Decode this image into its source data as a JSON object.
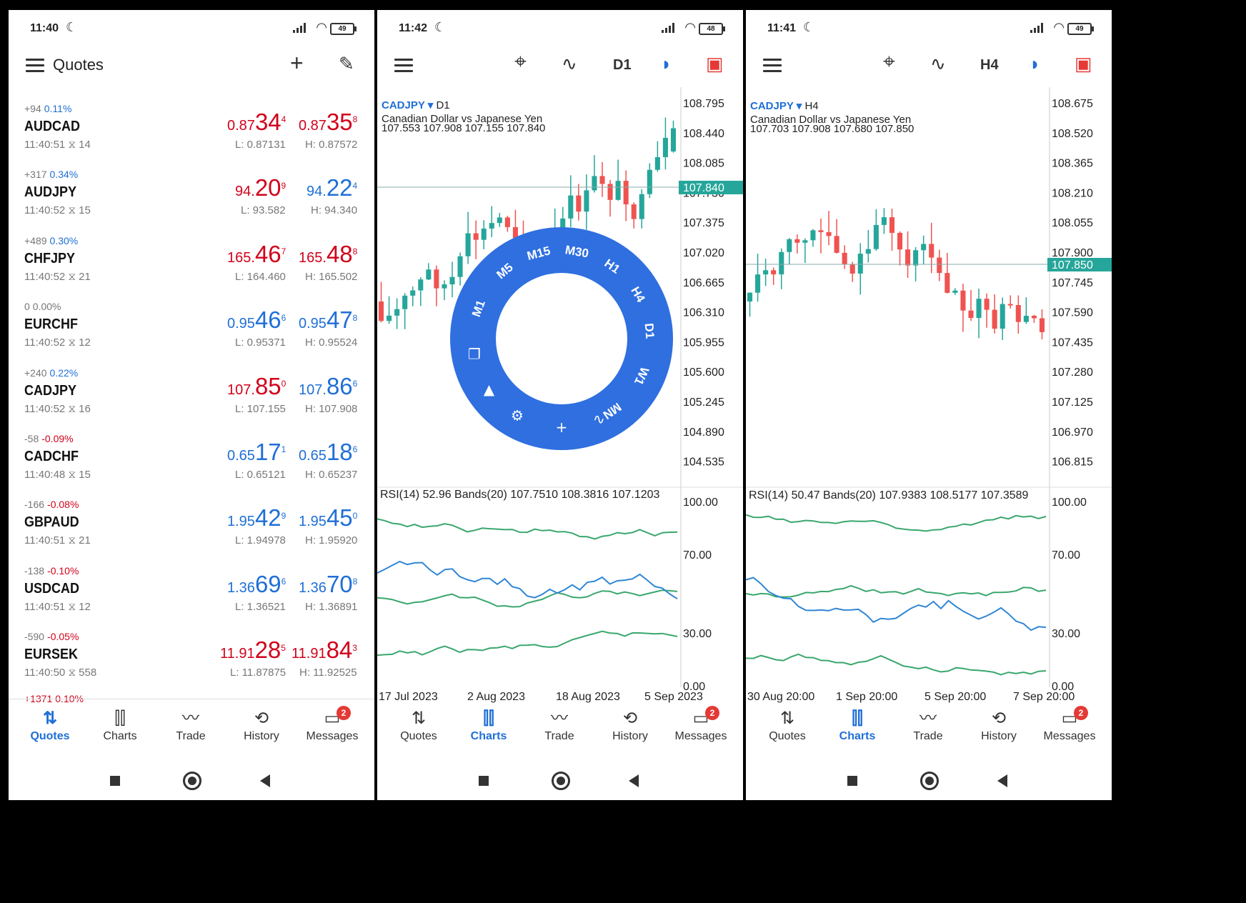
{
  "status": [
    {
      "time": "11:40",
      "battery": "49"
    },
    {
      "time": "11:42",
      "battery": "48"
    },
    {
      "time": "11:41",
      "battery": "49"
    }
  ],
  "quotes_screen": {
    "title": "Quotes",
    "rows": [
      {
        "chg": "+94",
        "pct": "0.11%",
        "pct_dir": "up",
        "symbol": "AUDCAD",
        "time": "11:40:51",
        "spread": "14",
        "bid_pre": "0.87",
        "bid_big": "34",
        "bid_sup": "4",
        "bid_color": "red",
        "ask_pre": "0.87",
        "ask_big": "35",
        "ask_sup": "8",
        "ask_color": "red",
        "low": "L: 0.87131",
        "high": "H: 0.87572"
      },
      {
        "chg": "+317",
        "pct": "0.34%",
        "pct_dir": "up",
        "symbol": "AUDJPY",
        "time": "11:40:52",
        "spread": "15",
        "bid_pre": "94.",
        "bid_big": "20",
        "bid_sup": "9",
        "bid_color": "red",
        "ask_pre": "94.",
        "ask_big": "22",
        "ask_sup": "4",
        "ask_color": "blue",
        "low": "L: 93.582",
        "high": "H: 94.340"
      },
      {
        "chg": "+489",
        "pct": "0.30%",
        "pct_dir": "up",
        "symbol": "CHFJPY",
        "time": "11:40:52",
        "spread": "21",
        "bid_pre": "165.",
        "bid_big": "46",
        "bid_sup": "7",
        "bid_color": "red",
        "ask_pre": "165.",
        "ask_big": "48",
        "ask_sup": "8",
        "ask_color": "red",
        "low": "L: 164.460",
        "high": "H: 165.502"
      },
      {
        "chg": "0",
        "pct": "0.00%",
        "pct_dir": "flat",
        "symbol": "EURCHF",
        "time": "11:40:52",
        "spread": "12",
        "bid_pre": "0.95",
        "bid_big": "46",
        "bid_sup": "6",
        "bid_color": "blue",
        "ask_pre": "0.95",
        "ask_big": "47",
        "ask_sup": "8",
        "ask_color": "blue",
        "low": "L: 0.95371",
        "high": "H: 0.95524"
      },
      {
        "chg": "+240",
        "pct": "0.22%",
        "pct_dir": "up",
        "symbol": "CADJPY",
        "time": "11:40:52",
        "spread": "16",
        "bid_pre": "107.",
        "bid_big": "85",
        "bid_sup": "0",
        "bid_color": "red",
        "ask_pre": "107.",
        "ask_big": "86",
        "ask_sup": "6",
        "ask_color": "blue",
        "low": "L: 107.155",
        "high": "H: 107.908"
      },
      {
        "chg": "-58",
        "pct": "-0.09%",
        "pct_dir": "down",
        "symbol": "CADCHF",
        "time": "11:40:48",
        "spread": "15",
        "bid_pre": "0.65",
        "bid_big": "17",
        "bid_sup": "1",
        "bid_color": "blue",
        "ask_pre": "0.65",
        "ask_big": "18",
        "ask_sup": "6",
        "ask_color": "blue",
        "low": "L: 0.65121",
        "high": "H: 0.65237"
      },
      {
        "chg": "-166",
        "pct": "-0.08%",
        "pct_dir": "down",
        "symbol": "GBPAUD",
        "time": "11:40:51",
        "spread": "21",
        "bid_pre": "1.95",
        "bid_big": "42",
        "bid_sup": "9",
        "bid_color": "blue",
        "ask_pre": "1.95",
        "ask_big": "45",
        "ask_sup": "0",
        "ask_color": "blue",
        "low": "L: 1.94978",
        "high": "H: 1.95920"
      },
      {
        "chg": "-138",
        "pct": "-0.10%",
        "pct_dir": "down",
        "symbol": "USDCAD",
        "time": "11:40:51",
        "spread": "12",
        "bid_pre": "1.36",
        "bid_big": "69",
        "bid_sup": "6",
        "bid_color": "blue",
        "ask_pre": "1.36",
        "ask_big": "70",
        "ask_sup": "8",
        "ask_color": "blue",
        "low": "L: 1.36521",
        "high": "H: 1.36891"
      },
      {
        "chg": "-590",
        "pct": "-0.05%",
        "pct_dir": "down",
        "symbol": "EURSEK",
        "time": "11:40:50",
        "spread": "558",
        "bid_pre": "11.91",
        "bid_big": "28",
        "bid_sup": "5",
        "bid_color": "red",
        "ask_pre": "11.91",
        "ask_big": "84",
        "ask_sup": "3",
        "ask_color": "red",
        "low": "L: 11.87875",
        "high": "H: 11.92525"
      }
    ],
    "partial_row": "+1371 0.10%"
  },
  "nav": {
    "items": [
      "Quotes",
      "Charts",
      "Trade",
      "History",
      "Messages"
    ],
    "badge": "2"
  },
  "charts": [
    {
      "symbol": "CADJPY",
      "timeframe": "D1",
      "toolbar_tf": "D1",
      "desc": "Canadian Dollar vs Japanese Yen",
      "ohlc": "107.553 107.908 107.155 107.840",
      "price_ticks": [
        "108.795",
        "108.440",
        "108.085",
        "107.730",
        "107.375",
        "107.020",
        "106.665",
        "106.310",
        "105.955",
        "105.600",
        "105.245",
        "104.890",
        "104.535"
      ],
      "current_price": "107.840",
      "indicator": "RSI(14) 52.96 Bands(20) 107.7510 108.3816 107.1203",
      "rsi_ticks": [
        "100.00",
        "70.00",
        "30.00",
        "0.00"
      ],
      "x_labels": [
        "17 Jul 2023",
        "2 Aug 2023",
        "18 Aug 2023",
        "5 Sep 2023"
      ],
      "wheel": [
        "M1",
        "M5",
        "M15",
        "M30",
        "H1",
        "H4",
        "D1",
        "W1",
        "MN"
      ]
    },
    {
      "symbol": "CADJPY",
      "timeframe": "H4",
      "toolbar_tf": "H4",
      "desc": "Canadian Dollar vs Japanese Yen",
      "ohlc": "107.703 107.908 107.680 107.850",
      "price_ticks": [
        "108.675",
        "108.520",
        "108.365",
        "108.210",
        "108.055",
        "107.900",
        "107.745",
        "107.590",
        "107.435",
        "107.280",
        "107.125",
        "106.970",
        "106.815"
      ],
      "current_price": "107.850",
      "indicator": "RSI(14) 50.47 Bands(20) 107.9383 108.5177 107.3589",
      "rsi_ticks": [
        "100.00",
        "70.00",
        "30.00",
        "0.00"
      ],
      "x_labels": [
        "30 Aug 20:00",
        "1 Sep 20:00",
        "5 Sep 20:00",
        "7 Sep 20:00"
      ]
    }
  ],
  "colors": {
    "bull": "#26a69a",
    "bear": "#ef5350",
    "accent": "#1f6fd6",
    "wheel": "#2f6fe0"
  }
}
